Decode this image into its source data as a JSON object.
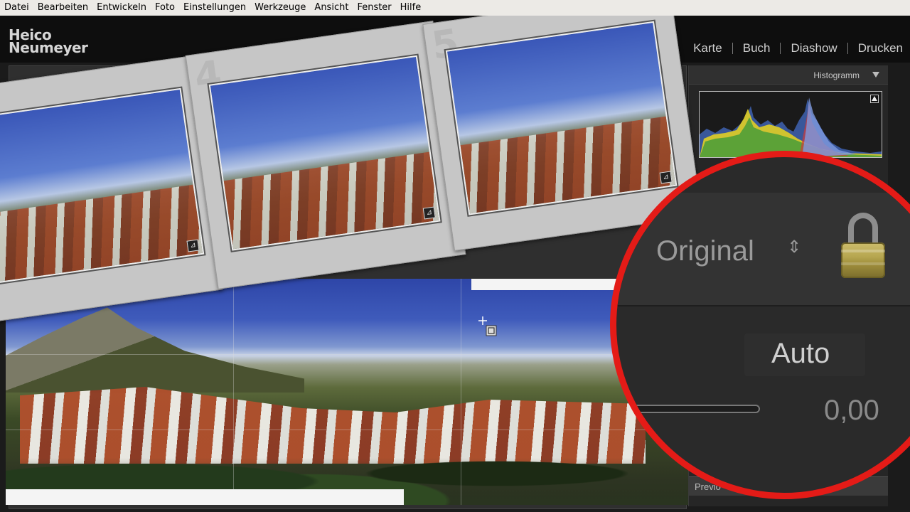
{
  "menu": [
    "Datei",
    "Bearbeiten",
    "Entwickeln",
    "Foto",
    "Einstellungen",
    "Werkzeuge",
    "Ansicht",
    "Fenster",
    "Hilfe"
  ],
  "brand": {
    "line1": "Heico",
    "line2": "Neumeyer"
  },
  "modules": [
    "Karte",
    "Buch",
    "Diashow",
    "Drucken"
  ],
  "panel": {
    "histogram_label": "Histogramm",
    "preview_label": "Previo"
  },
  "filmstrip": {
    "frame_numbers": [
      "4",
      "5"
    ],
    "badge_glyph": "⊿"
  },
  "magnifier": {
    "profile_label": "Original",
    "updown_glyph": "⇕",
    "auto_label": "Auto",
    "value": "0,00"
  },
  "colors": {
    "accent_ring": "#e41b17",
    "menu_bg": "#eceae6"
  }
}
